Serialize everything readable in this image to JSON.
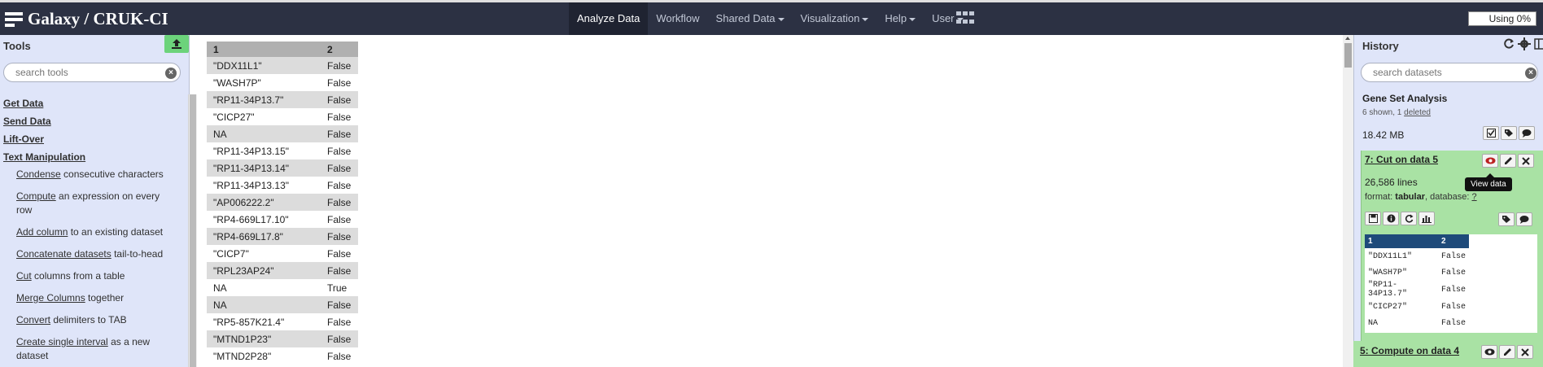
{
  "brand": {
    "title": "Galaxy / CRUK-CI"
  },
  "nav": {
    "items": [
      {
        "label": "Analyze Data",
        "active": true,
        "dropdown": false
      },
      {
        "label": "Workflow",
        "active": false,
        "dropdown": false
      },
      {
        "label": "Shared Data",
        "active": false,
        "dropdown": true
      },
      {
        "label": "Visualization",
        "active": false,
        "dropdown": true
      },
      {
        "label": "Help",
        "active": false,
        "dropdown": true
      },
      {
        "label": "User",
        "active": false,
        "dropdown": true
      }
    ],
    "quota": "Using 0%"
  },
  "tools": {
    "title": "Tools",
    "search_placeholder": "search tools",
    "sections": [
      "Get Data",
      "Send Data",
      "Lift-Over",
      "Text Manipulation"
    ],
    "items": [
      {
        "link": "Condense",
        "desc": " consecutive characters"
      },
      {
        "link": "Compute",
        "desc": " an expression on every row"
      },
      {
        "link": "Add column",
        "desc": " to an existing dataset"
      },
      {
        "link": "Concatenate datasets",
        "desc": " tail-to-head"
      },
      {
        "link": "Cut",
        "desc": " columns from a table"
      },
      {
        "link": "Merge Columns",
        "desc": " together"
      },
      {
        "link": "Convert",
        "desc": " delimiters to TAB"
      },
      {
        "link": "Create single interval",
        "desc": " as a new dataset"
      }
    ]
  },
  "center": {
    "headers": [
      "1",
      "2"
    ],
    "rows": [
      [
        "\"DDX11L1\"",
        "False"
      ],
      [
        "\"WASH7P\"",
        "False"
      ],
      [
        "\"RP11-34P13.7\"",
        "False"
      ],
      [
        "\"CICP27\"",
        "False"
      ],
      [
        "NA",
        "False"
      ],
      [
        "\"RP11-34P13.15\"",
        "False"
      ],
      [
        "\"RP11-34P13.14\"",
        "False"
      ],
      [
        "\"RP11-34P13.13\"",
        "False"
      ],
      [
        "\"AP006222.2\"",
        "False"
      ],
      [
        "\"RP4-669L17.10\"",
        "False"
      ],
      [
        "\"RP4-669L17.8\"",
        "False"
      ],
      [
        "\"CICP7\"",
        "False"
      ],
      [
        "\"RPL23AP24\"",
        "False"
      ],
      [
        "NA",
        "True"
      ],
      [
        "NA",
        "False"
      ],
      [
        "\"RP5-857K21.4\"",
        "False"
      ],
      [
        "\"MTND1P23\"",
        "False"
      ],
      [
        "\"MTND2P28\"",
        "False"
      ]
    ]
  },
  "history": {
    "title": "History",
    "search_placeholder": "search datasets",
    "name": "Gene Set Analysis",
    "shown_text": "6 shown, 1 ",
    "deleted_link": "deleted",
    "size": "18.42 MB",
    "datasets": [
      {
        "title": "7: Cut on data 5",
        "lines": "26,586 lines",
        "format_prefix": "format: ",
        "format": "tabular",
        "database_prefix": ", database: ",
        "database": "?",
        "peek_headers": [
          "1",
          "2"
        ],
        "peek_rows": [
          [
            "\"DDX11L1\"",
            "False"
          ],
          [
            "\"WASH7P\"",
            "False"
          ],
          [
            "\"RP11-34P13.7\"",
            "False"
          ],
          [
            "\"CICP27\"",
            "False"
          ],
          [
            "NA",
            "False"
          ]
        ]
      },
      {
        "title": "5: Compute on data 4"
      }
    ],
    "tooltip": "View data"
  },
  "colors": {
    "topbar": "#2c3143",
    "panel": "#dfe5f9",
    "dataset_ok": "#a9e2a4",
    "upload": "#6cd37b",
    "peek_header": "#1e4a7a"
  }
}
